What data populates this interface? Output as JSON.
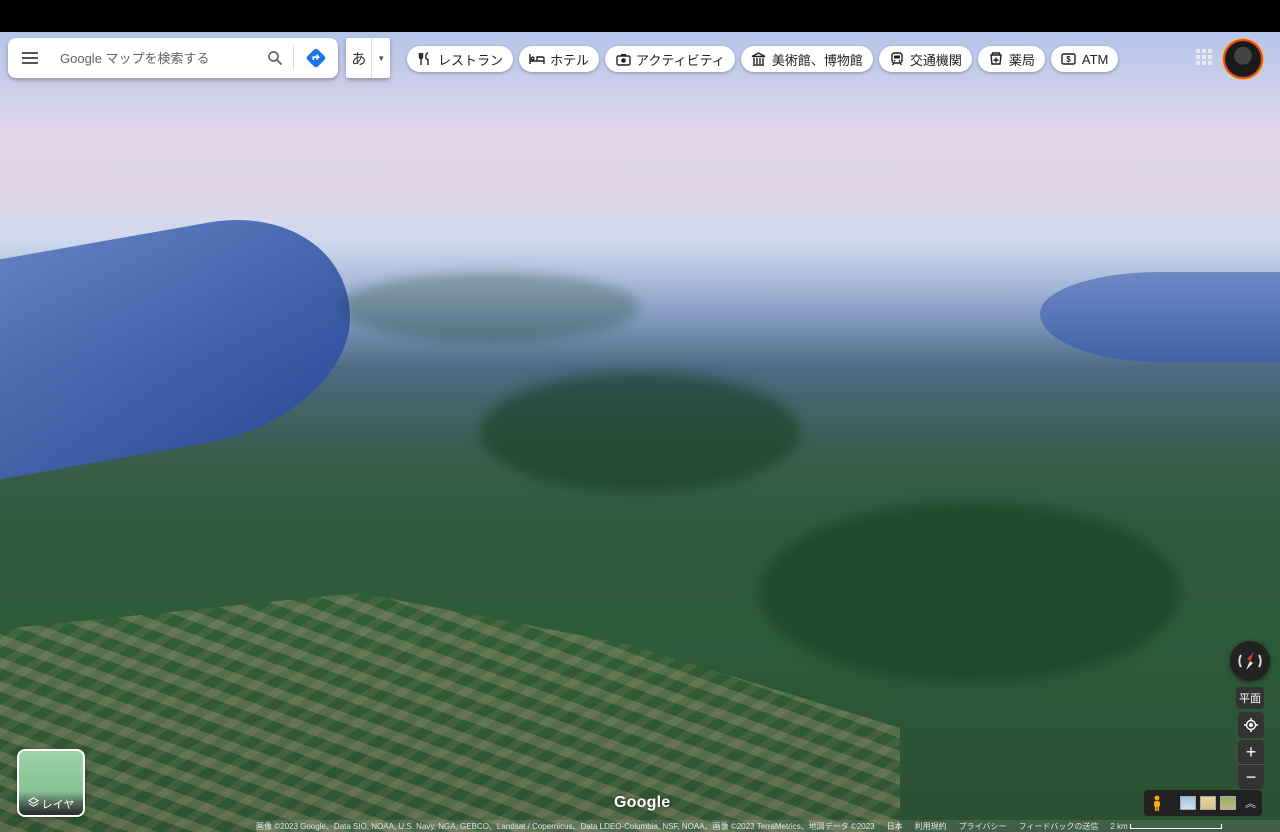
{
  "search": {
    "placeholder": "Google マップを検索する"
  },
  "ime": {
    "label": "あ"
  },
  "chips": [
    {
      "label": "レストラン",
      "icon": "restaurant-icon"
    },
    {
      "label": "ホテル",
      "icon": "hotel-icon"
    },
    {
      "label": "アクティビティ",
      "icon": "camera-icon"
    },
    {
      "label": "美術館、博物館",
      "icon": "museum-icon"
    },
    {
      "label": "交通機関",
      "icon": "transit-icon"
    },
    {
      "label": "薬局",
      "icon": "pharmacy-icon"
    },
    {
      "label": "ATM",
      "icon": "atm-icon"
    }
  ],
  "map": {
    "logo": "Google"
  },
  "layers": {
    "label": "レイヤ"
  },
  "controls": {
    "flat_label": "平面",
    "zoom_in": "+",
    "zoom_out": "−"
  },
  "footer": {
    "imagery": "画像 ©2023 Google、Data SIO, NOAA, U.S. Navy, NGA, GEBCO、Landsat / Copernicus、Data LDEO-Columbia, NSF, NOAA、画像 ©2023 TerraMetrics、地図データ ©2023",
    "region": "日本",
    "terms": "利用規約",
    "privacy": "プライバシー",
    "feedback": "フィードバックの送信",
    "scale": "2 km"
  }
}
